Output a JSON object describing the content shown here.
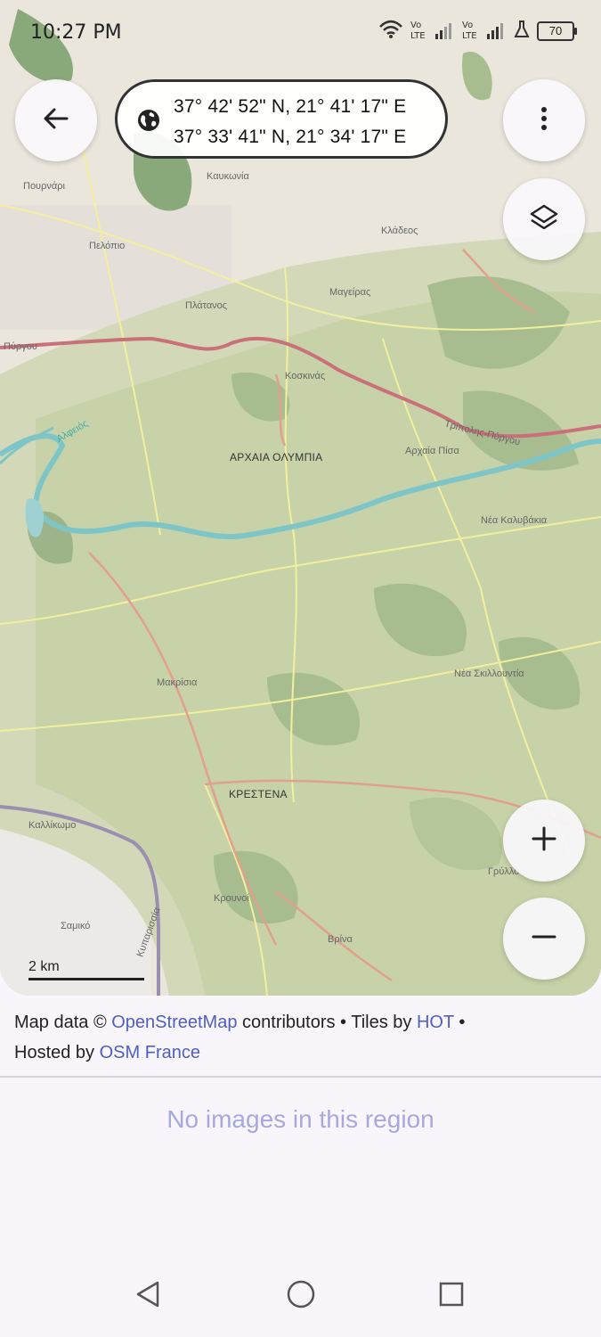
{
  "status_bar": {
    "time": "10:27 PM",
    "battery": "70",
    "icons": [
      "wifi-icon",
      "volte-signal-icon",
      "volte-signal-icon",
      "flask-icon",
      "battery-icon"
    ]
  },
  "coords": {
    "line1": "37° 42' 52\" N, 21° 41' 17\" E",
    "line2": "37° 33' 41\" N, 21° 34' 17\" E"
  },
  "buttons": {
    "back": "arrow-left-icon",
    "menu": "more-vertical-icon",
    "layers": "layers-icon",
    "zoom_in": "plus-icon",
    "zoom_out": "minus-icon"
  },
  "map_labels": {
    "archaia_olympia": "ΑΡΧΑΙΑ ΟΛΥΜΠΙΑ",
    "krestena": "ΚΡΕΣΤΕΝΑ",
    "pourgou_left": "Πύργου",
    "tripolis": "Τρίπολης-Πύργου",
    "archaia_pisa": "Αρχαία Πίσα",
    "nea_kalyvakia": "Νέα Καλυβάκια",
    "makrisia": "Μακρίσια",
    "nea_skillountia": "Νέα Σκιλλουντία",
    "kallikomo": "Καλλίκωμο",
    "samiko": "Σαμικό",
    "platanos": "Πλάτανος",
    "magiras": "Μαγείρας",
    "kladeos": "Κλάδεος",
    "kaukonia": "Καυκωνία",
    "pournari": "Πουρνάρι",
    "pelopio": "Πελόπιο",
    "krouni": "Κρουνοί",
    "vrina": "Βρίνα",
    "alfeios": "Αλφειός",
    "kosikias": "Κοσκινάς",
    "kyparissia": "Κυπαρισσία",
    "grylos": "Γρύλλος"
  },
  "scale": {
    "label": "2 km"
  },
  "attribution": {
    "prefix": "Map data © ",
    "osm_link": "OpenStreetMap",
    "middle": " contributors • Tiles by ",
    "hot_link": "HOT",
    "sep": " •",
    "hosted": "Hosted by ",
    "osmfr_link": "OSM France"
  },
  "empty_message": "No images in this region",
  "nav": {
    "back": "nav-back-icon",
    "home": "nav-home-icon",
    "recents": "nav-recents-icon"
  }
}
